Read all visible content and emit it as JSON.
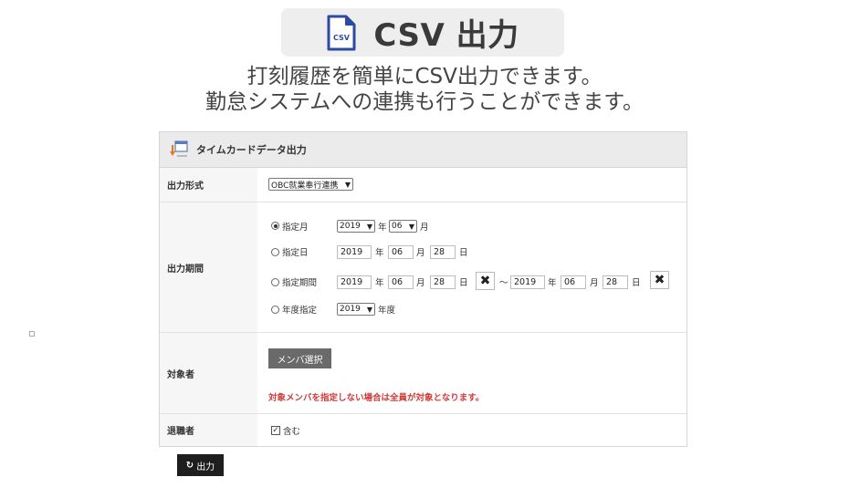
{
  "header": {
    "title": "CSV 出力",
    "icon": "csv-file-icon",
    "icon_label": "CSV",
    "accent": "#2c4a9e"
  },
  "subtitle": {
    "line1": "打刻履歴を簡単にCSV出力できます。",
    "line2": "勤怠システムへの連携も行うことができます。"
  },
  "panel": {
    "title": "タイムカードデータ出力",
    "icon": "timecard-export-icon",
    "format": {
      "label": "出力形式",
      "selected": "OBC就業奉行連携"
    },
    "period": {
      "label": "出力期間",
      "options": {
        "month": {
          "label": "指定月",
          "selected": true,
          "year": "2019",
          "year_unit": "年",
          "month": "06",
          "month_unit": "月"
        },
        "day": {
          "label": "指定日",
          "selected": false,
          "year": "2019",
          "year_unit": "年",
          "month": "06",
          "month_unit": "月",
          "day": "28",
          "day_unit": "日"
        },
        "range": {
          "label": "指定期間",
          "selected": false,
          "from": {
            "year": "2019",
            "month": "06",
            "day": "28"
          },
          "to": {
            "year": "2019",
            "month": "06",
            "day": "28"
          },
          "year_unit": "年",
          "month_unit": "月",
          "day_unit": "日",
          "tilde": "～",
          "clear_icon": "✖"
        },
        "fiscal": {
          "label": "年度指定",
          "selected": false,
          "year": "2019",
          "unit": "年度"
        }
      }
    },
    "target": {
      "label": "対象者",
      "button": "メンバ選択",
      "warning": "対象メンバを指定しない場合は全員が対象となります。",
      "warning_color": "#d23a3a"
    },
    "retired": {
      "label": "退職者",
      "checkbox_label": "含む",
      "checked": true,
      "check_mark": "✓"
    }
  },
  "output_button": {
    "label": "出力",
    "icon": "refresh-icon",
    "icon_glyph": "↻"
  }
}
